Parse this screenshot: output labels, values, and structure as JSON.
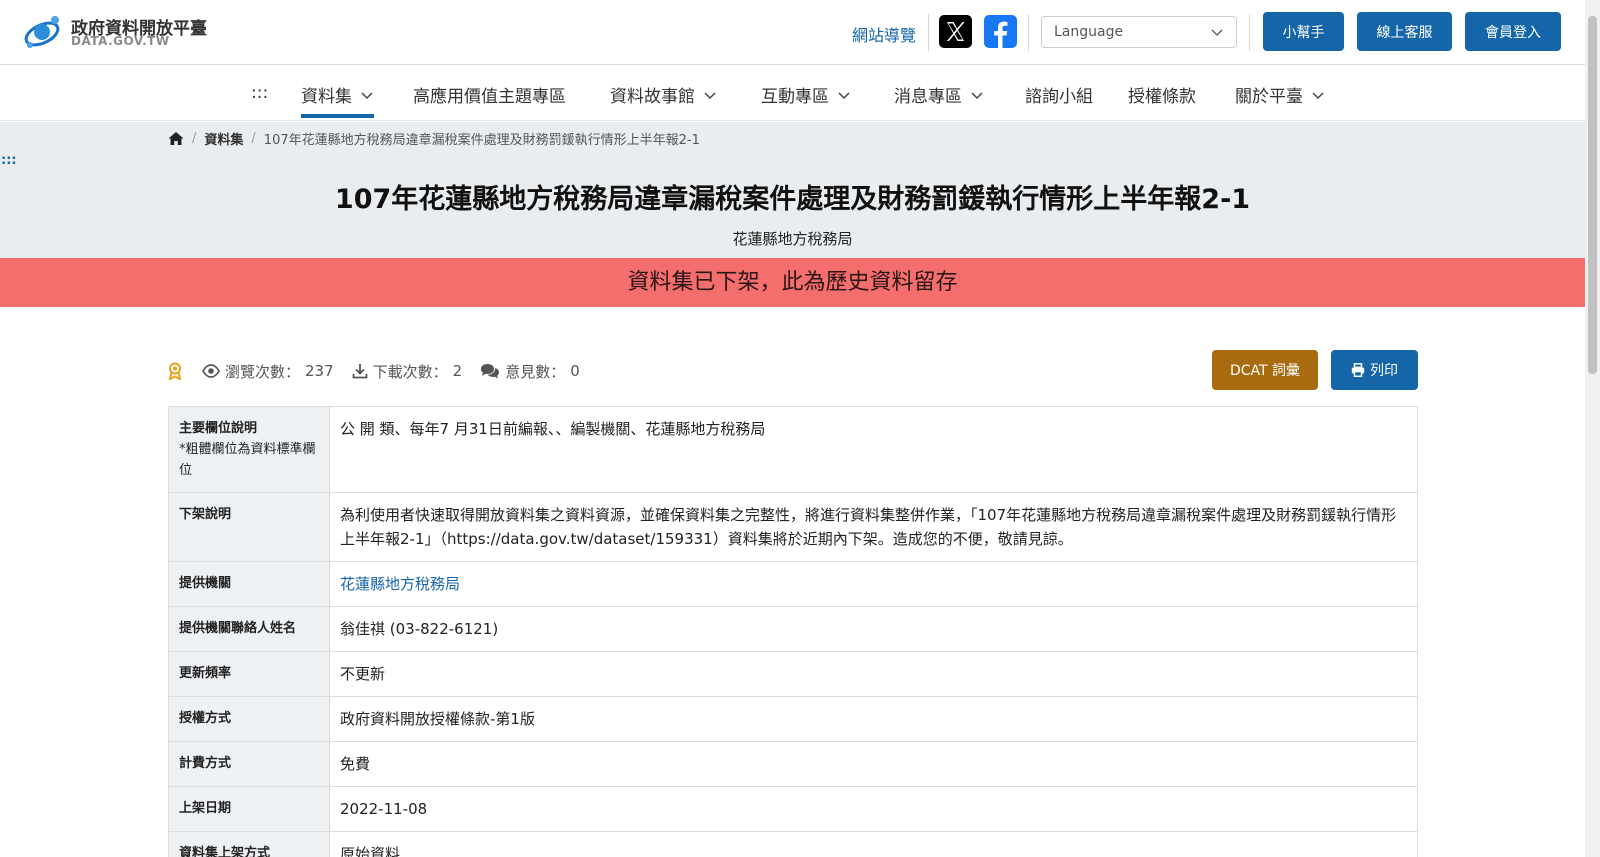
{
  "header": {
    "logo_title": "政府資料開放平臺",
    "logo_sub": "DATA.GOV.TW",
    "sitemap": "網站導覽",
    "language_placeholder": "Language",
    "buttons": [
      "小幫手",
      "線上客服",
      "會員登入"
    ]
  },
  "nav": {
    "skip": ":::",
    "items": [
      {
        "label": "資料集",
        "has_dropdown": true,
        "active": true
      },
      {
        "label": "高應用價值主題專區",
        "has_dropdown": false,
        "active": false
      },
      {
        "label": "資料故事館",
        "has_dropdown": true,
        "active": false
      },
      {
        "label": "互動專區",
        "has_dropdown": true,
        "active": false
      },
      {
        "label": "消息專區",
        "has_dropdown": true,
        "active": false
      },
      {
        "label": "諮詢小組",
        "has_dropdown": false,
        "active": false
      },
      {
        "label": "授權條款",
        "has_dropdown": false,
        "active": false
      },
      {
        "label": "關於平臺",
        "has_dropdown": true,
        "active": false
      }
    ]
  },
  "breadcrumb": {
    "level1": "資料集",
    "current": "107年花蓮縣地方稅務局違章漏稅案件處理及財務罰鍰執行情形上半年報2-1"
  },
  "anchor_dots": ":::",
  "page": {
    "title": "107年花蓮縣地方稅務局違章漏稅案件處理及財務罰鍰執行情形上半年報2-1",
    "agency": "花蓮縣地方稅務局",
    "alert": "資料集已下架，此為歷史資料留存"
  },
  "stats": {
    "views_label": "瀏覽次數：",
    "views": "237",
    "downloads_label": "下載次數：",
    "downloads": "2",
    "comments_label": "意見數：",
    "comments": "0"
  },
  "actions": {
    "dcat": "DCAT 詞彙",
    "print": "列印"
  },
  "details": [
    {
      "label": "主要欄位說明",
      "note": "*粗體欄位為資料標準欄位",
      "value": "公 開 類、每年7 月31日前編報、、編製機關、花蓮縣地方稅務局",
      "is_link": false
    },
    {
      "label": "下架說明",
      "note": "",
      "value": "為利使用者快速取得開放資料集之資料資源，並確保資料集之完整性，將進行資料集整併作業，「107年花蓮縣地方稅務局違章漏稅案件處理及財務罰鍰執行情形上半年報2-1」（https://data.gov.tw/dataset/159331）資料集將於近期內下架。造成您的不便，敬請見諒。",
      "is_link": false
    },
    {
      "label": "提供機關",
      "note": "",
      "value": "花蓮縣地方稅務局",
      "is_link": true
    },
    {
      "label": "提供機關聯絡人姓名",
      "note": "",
      "value": "翁佳祺 (03-822-6121)",
      "is_link": false
    },
    {
      "label": "更新頻率",
      "note": "",
      "value": "不更新",
      "is_link": false
    },
    {
      "label": "授權方式",
      "note": "",
      "value": "政府資料開放授權條款-第1版",
      "is_link": false
    },
    {
      "label": "計費方式",
      "note": "",
      "value": "免費",
      "is_link": false
    },
    {
      "label": "上架日期",
      "note": "",
      "value": "2022-11-08",
      "is_link": false
    },
    {
      "label": "資料集上架方式",
      "note": "",
      "value": "原始資料",
      "is_link": false
    }
  ],
  "colors": {
    "primary": "#1565a9",
    "alert_bg": "#f46e6e",
    "dcat_bg": "#a86b10",
    "hero_bg": "#e9edf0",
    "label_bg": "#eef1f4"
  }
}
